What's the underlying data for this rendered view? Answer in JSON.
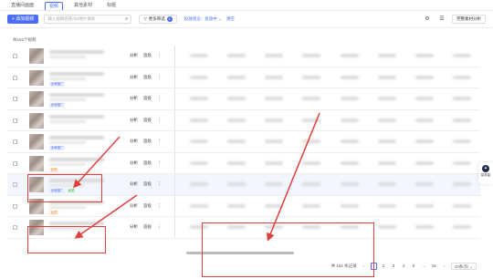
{
  "tabs": [
    {
      "label": "直播间画面",
      "active": false
    },
    {
      "label": "视频",
      "active": true
    },
    {
      "label": "其他素材",
      "active": false
    },
    {
      "label": "标题",
      "active": false
    }
  ],
  "toolbar": {
    "add_label": "+ 添加视频",
    "search_placeholder": "输入视频名称/ID/图片搜索",
    "filter_label": "更多筛选",
    "filter_count": "1",
    "status_label": "投放状态：投放中",
    "clear_label": "清空",
    "gear_icon": "⚙",
    "columns_icon": "☰",
    "analysis_label": "完整素材分析"
  },
  "table": {
    "total_hint": "共152个视频",
    "rows": [
      {
        "tags": [],
        "highlight": false
      },
      {
        "tags": [
          {
            "text": "全域推广",
            "color": "blue"
          }
        ],
        "highlight": false
      },
      {
        "tags": [
          {
            "text": "全域推广",
            "color": "blue"
          }
        ],
        "highlight": false
      },
      {
        "tags": [],
        "highlight": false
      },
      {
        "tags": [
          {
            "text": "全域推广",
            "color": "blue"
          }
        ],
        "highlight": false
      },
      {
        "tags": [
          {
            "text": "优质",
            "color": "orange"
          }
        ],
        "highlight": false
      },
      {
        "tags": [
          {
            "text": "全域推广",
            "color": "blue"
          },
          {
            "text": "优质",
            "color": "green"
          }
        ],
        "highlight": true
      },
      {
        "tags": [
          {
            "text": "优质",
            "color": "orange"
          }
        ],
        "highlight": false
      },
      {
        "tags": [],
        "highlight": false
      }
    ],
    "action_analyze": "分析",
    "action_track": "追投",
    "action_more": "⋮"
  },
  "pagination": {
    "total": "共 152 条记录",
    "prev": "‹",
    "pages": [
      "1",
      "2",
      "3",
      "4",
      "5",
      "…",
      "16"
    ],
    "current": "1",
    "next": "›",
    "page_size": "10条/页"
  },
  "side_widget": {
    "label": "智投星"
  },
  "annotation_color": "#e0403c",
  "accent_color": "#4b6ef5"
}
